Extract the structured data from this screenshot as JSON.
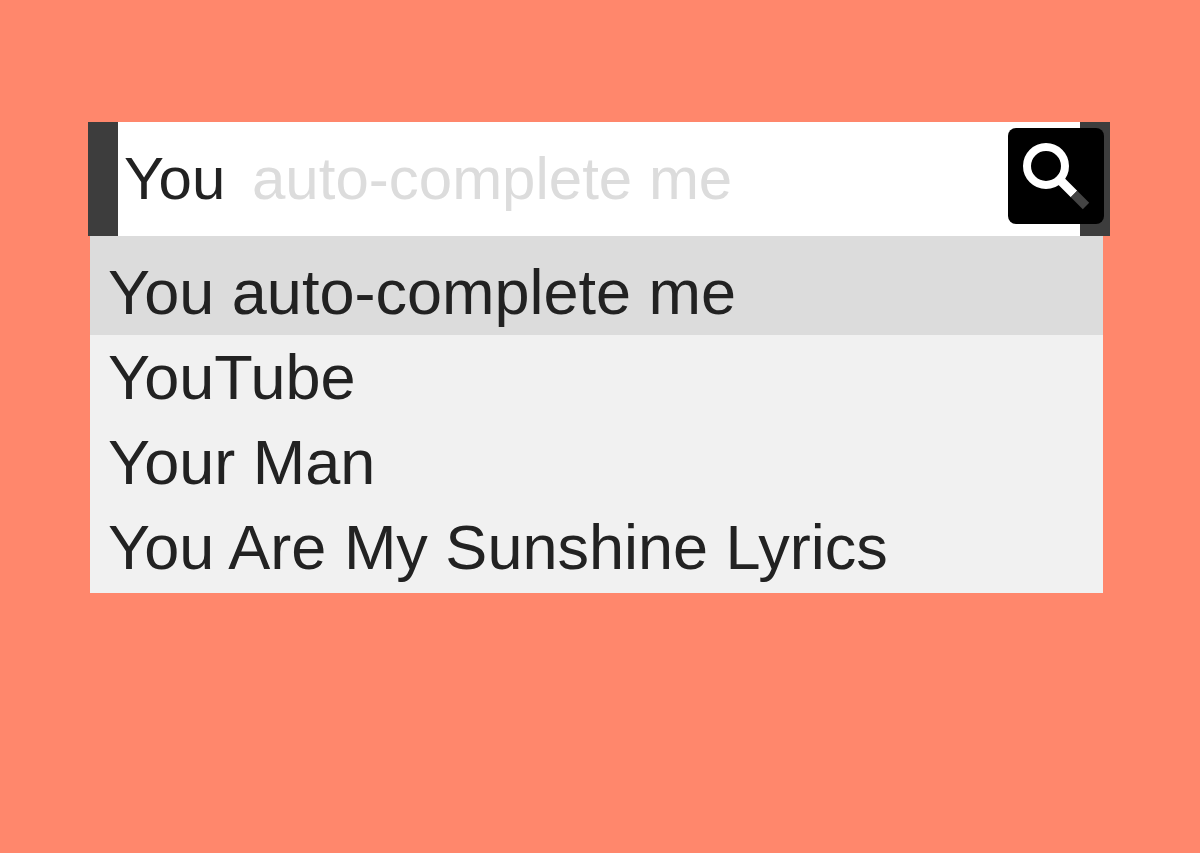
{
  "search": {
    "value": "You",
    "completion": "auto-complete me"
  },
  "suggestions": [
    {
      "text": "You auto-complete me",
      "selected": true
    },
    {
      "text": "YouTube",
      "selected": false
    },
    {
      "text": "Your Man",
      "selected": false
    },
    {
      "text": "You Are My Sunshine Lyrics",
      "selected": false
    }
  ]
}
